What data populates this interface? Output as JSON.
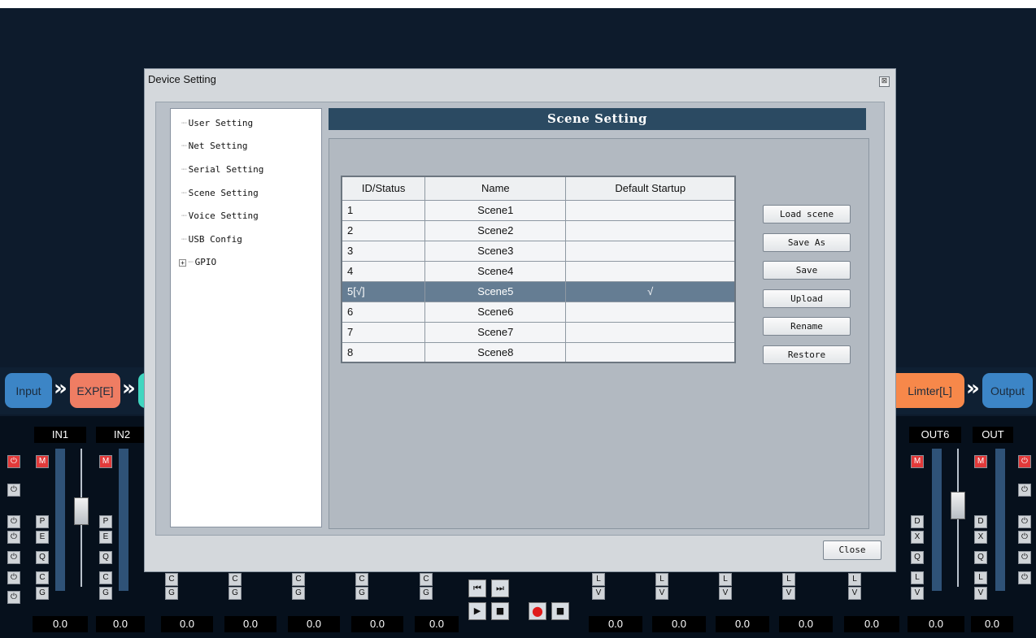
{
  "dialog": {
    "title": "Device Setting",
    "close_x": "⊠",
    "close_button": "Close"
  },
  "tree": {
    "items": [
      {
        "label": "User Setting"
      },
      {
        "label": "Net Setting"
      },
      {
        "label": "Serial Setting"
      },
      {
        "label": "Scene Setting"
      },
      {
        "label": "Voice Setting"
      },
      {
        "label": "USB Config"
      },
      {
        "label": "GPIO",
        "expander": "+"
      }
    ]
  },
  "panel": {
    "title": "Scene Setting",
    "columns": [
      "ID/Status",
      "Name",
      "Default Startup"
    ],
    "rows": [
      {
        "id": "1",
        "name": "Scene1",
        "default": ""
      },
      {
        "id": "2",
        "name": "Scene2",
        "default": ""
      },
      {
        "id": "3",
        "name": "Scene3",
        "default": ""
      },
      {
        "id": "4",
        "name": "Scene4",
        "default": ""
      },
      {
        "id": "5[√]",
        "name": "Scene5",
        "default": "√"
      },
      {
        "id": "6",
        "name": "Scene6",
        "default": ""
      },
      {
        "id": "7",
        "name": "Scene7",
        "default": ""
      },
      {
        "id": "8",
        "name": "Scene8",
        "default": ""
      }
    ],
    "buttons": {
      "load": "Load scene",
      "save_as": "Save As",
      "save": "Save",
      "upload": "Upload",
      "rename": "Rename",
      "restore": "Restore"
    }
  },
  "flow": {
    "input": "Input",
    "exp": "EXP[E]",
    "limiter": "Limter[L]",
    "output": "Output",
    "arrow": "»"
  },
  "mixer": {
    "channels": {
      "in1": "IN1",
      "in2": "IN2",
      "out6": "OUT6",
      "out7": "OUT"
    },
    "value": "0.0",
    "scale": {
      "top": "24",
      "mid": "0",
      "low": "-24",
      "bottom": "-60"
    },
    "button_letters": {
      "mute": "M",
      "p": "P",
      "e": "E",
      "q": "Q",
      "c": "C",
      "g": "G",
      "d": "D",
      "x": "X",
      "l": "L",
      "v": "V"
    },
    "transport": {
      "prev": "⏮",
      "next": "⏭",
      "play": "▶",
      "stop": "■",
      "record": "●"
    }
  },
  "colors": {
    "input_block": "#3c85c6",
    "exp_block": "#ef7d63",
    "limiter_block": "#f7884a",
    "output_block": "#3c85c6",
    "header_bar": "#2b4a62",
    "selected_row": "#657d93"
  }
}
